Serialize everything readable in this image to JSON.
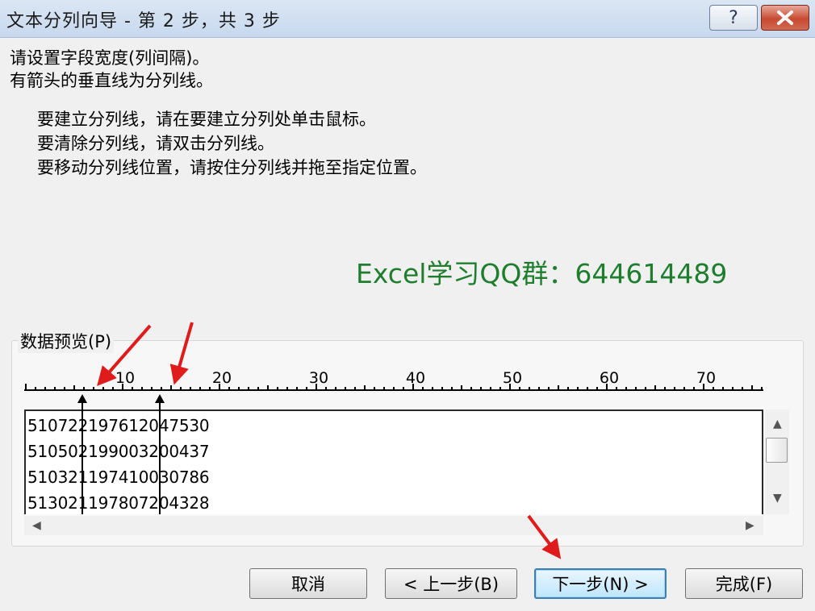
{
  "window": {
    "title": "文本分列向导 - 第 2 步，共 3 步",
    "help_label": "?",
    "colors": {
      "titlebar": "#c8d9ee",
      "close": "#c74a32",
      "annotation_arrow": "#e01b1b",
      "watermark": "#1e7e2e"
    }
  },
  "instructions": {
    "line1": "请设置字段宽度(列间隔)。",
    "line2": "有箭头的垂直线为分列线。",
    "tip1": "要建立分列线，请在要建立分列处单击鼠标。",
    "tip2": "要清除分列线，请双击分列线。",
    "tip3": "要移动分列线位置，请按住分列线并拖至指定位置。"
  },
  "watermark": "Excel学习QQ群：644614489",
  "preview": {
    "label": "数据预览(P)",
    "ruler_labels": [
      "10",
      "20",
      "30",
      "40",
      "50",
      "60",
      "70"
    ],
    "rows": [
      "510722197612047530",
      "510502199003200437",
      "510321197410030786",
      "513021197807204328"
    ],
    "break_columns": [
      6,
      14
    ]
  },
  "buttons": {
    "cancel": "取消",
    "back": "< 上一步(B)",
    "next": "下一步(N) >",
    "finish": "完成(F)"
  }
}
